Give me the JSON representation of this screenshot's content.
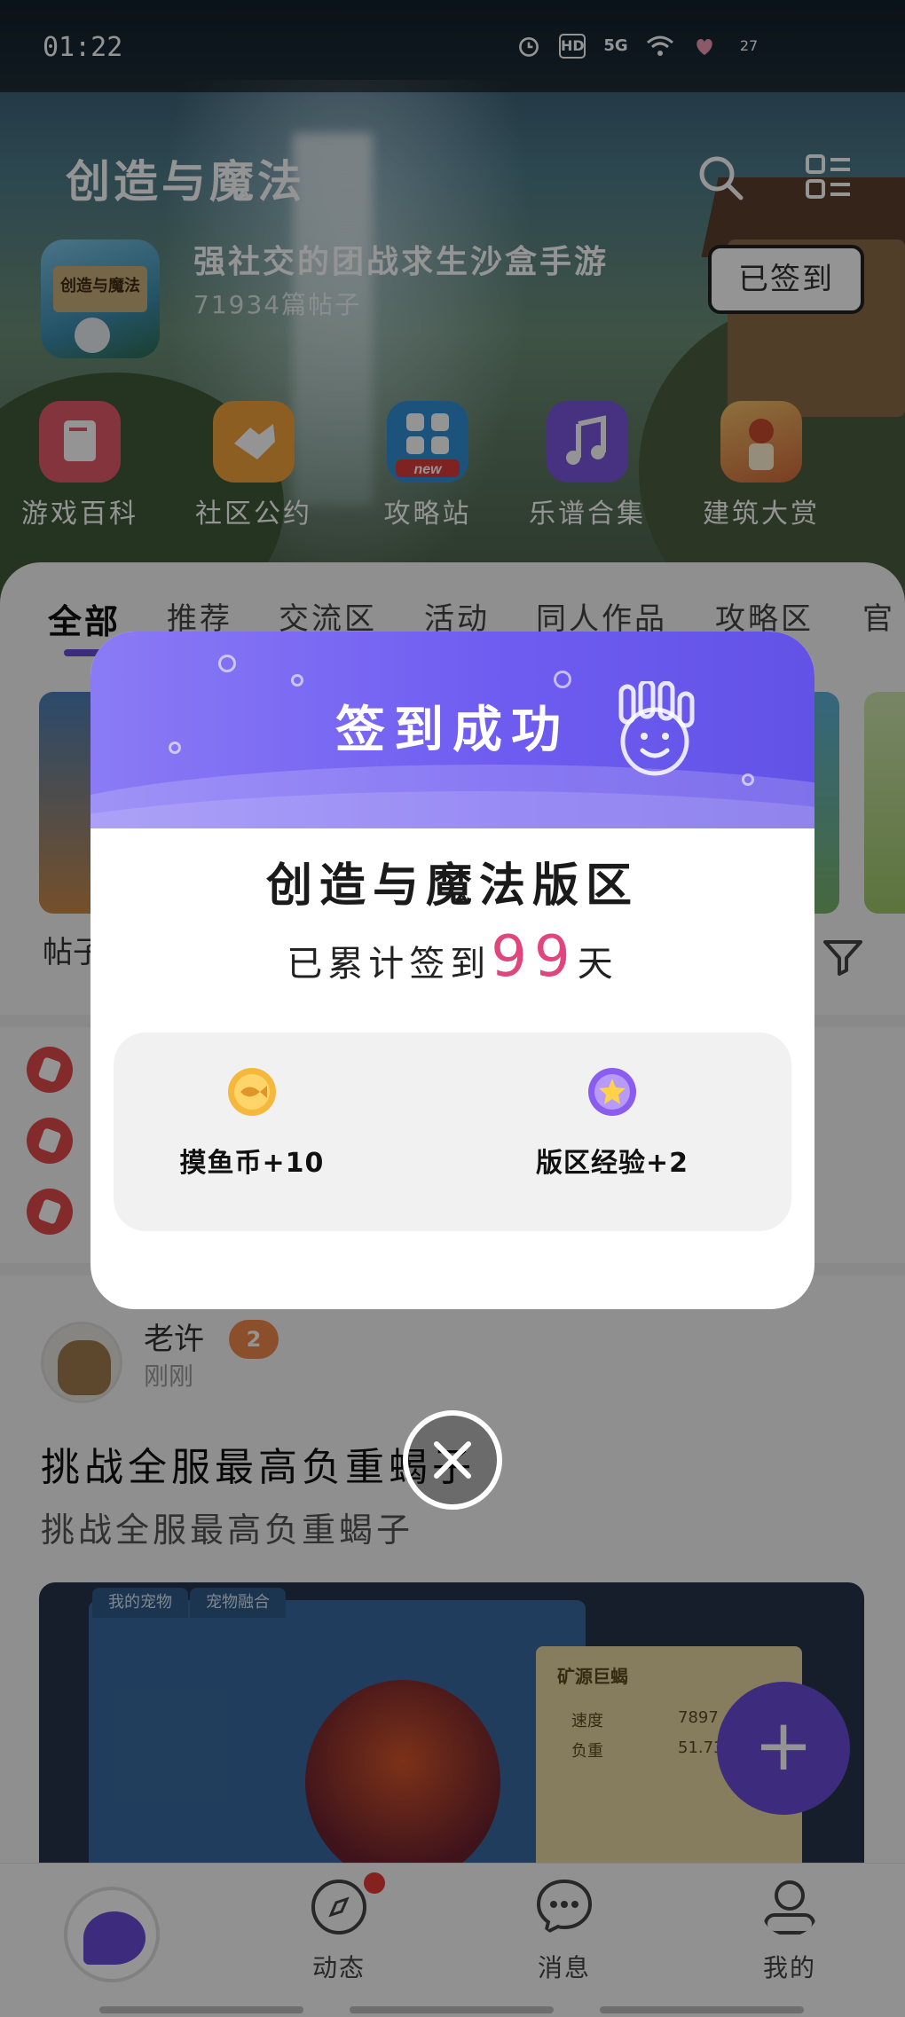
{
  "status_bar": {
    "time": "01:22",
    "icons": [
      "alarm-icon",
      "hd-icon",
      "5g-icon",
      "wifi-icon",
      "battery-icon"
    ],
    "hd_label": "HD",
    "net_label": "5G",
    "battery_label": "27"
  },
  "header": {
    "title": "创造与魔法",
    "description": "强社交的团战求生沙盒手游",
    "post_count": "71934篇帖子",
    "checkin_label": "已签到",
    "logo_text": "创造与魔法"
  },
  "shortcuts": [
    {
      "label": "游戏百科",
      "icon": "book-icon",
      "color": "#e35b6a"
    },
    {
      "label": "社区公约",
      "icon": "handshake-icon",
      "color": "#f2a23c"
    },
    {
      "label": "攻略站",
      "icon": "grid-new-icon",
      "color": "#2f8fd6",
      "badge": "new"
    },
    {
      "label": "乐谱合集",
      "icon": "music-icon",
      "color": "#7b56e0"
    },
    {
      "label": "建筑大赏",
      "icon": "building-icon",
      "color": "#e8a04a"
    }
  ],
  "tabs": [
    "全部",
    "推荐",
    "交流区",
    "活动",
    "同人作品",
    "攻略区",
    "官"
  ],
  "banner_label": "帖子",
  "post": {
    "author": "老许",
    "time": "刚刚",
    "level": "2",
    "title": "挑战全服最高负重蝎子",
    "subtitle": "挑战全服最高负重蝎子",
    "image_tabs": [
      "我的宠物",
      "宠物融合"
    ],
    "image_card_title": "矿源巨蝎",
    "image_card_rows": [
      {
        "label": "速度",
        "value": "7897"
      },
      {
        "label": "负重",
        "value": "51.737"
      }
    ]
  },
  "fab_label": "+",
  "bottom_nav": [
    {
      "label": "动态",
      "icon": "compass-icon"
    },
    {
      "label": "消息",
      "icon": "chat-icon"
    },
    {
      "label": "我的",
      "icon": "profile-icon"
    }
  ],
  "modal": {
    "title": "签到成功",
    "board": "创造与魔法版区",
    "days_prefix": "已累计签到",
    "days_value": "99",
    "days_suffix": "天",
    "rewards": [
      {
        "label": "摸鱼币+10",
        "icon": "fish-coin-icon",
        "color": "#f5b83c"
      },
      {
        "label": "版区经验+2",
        "icon": "star-badge-icon",
        "color": "#8a5cf0"
      }
    ]
  }
}
